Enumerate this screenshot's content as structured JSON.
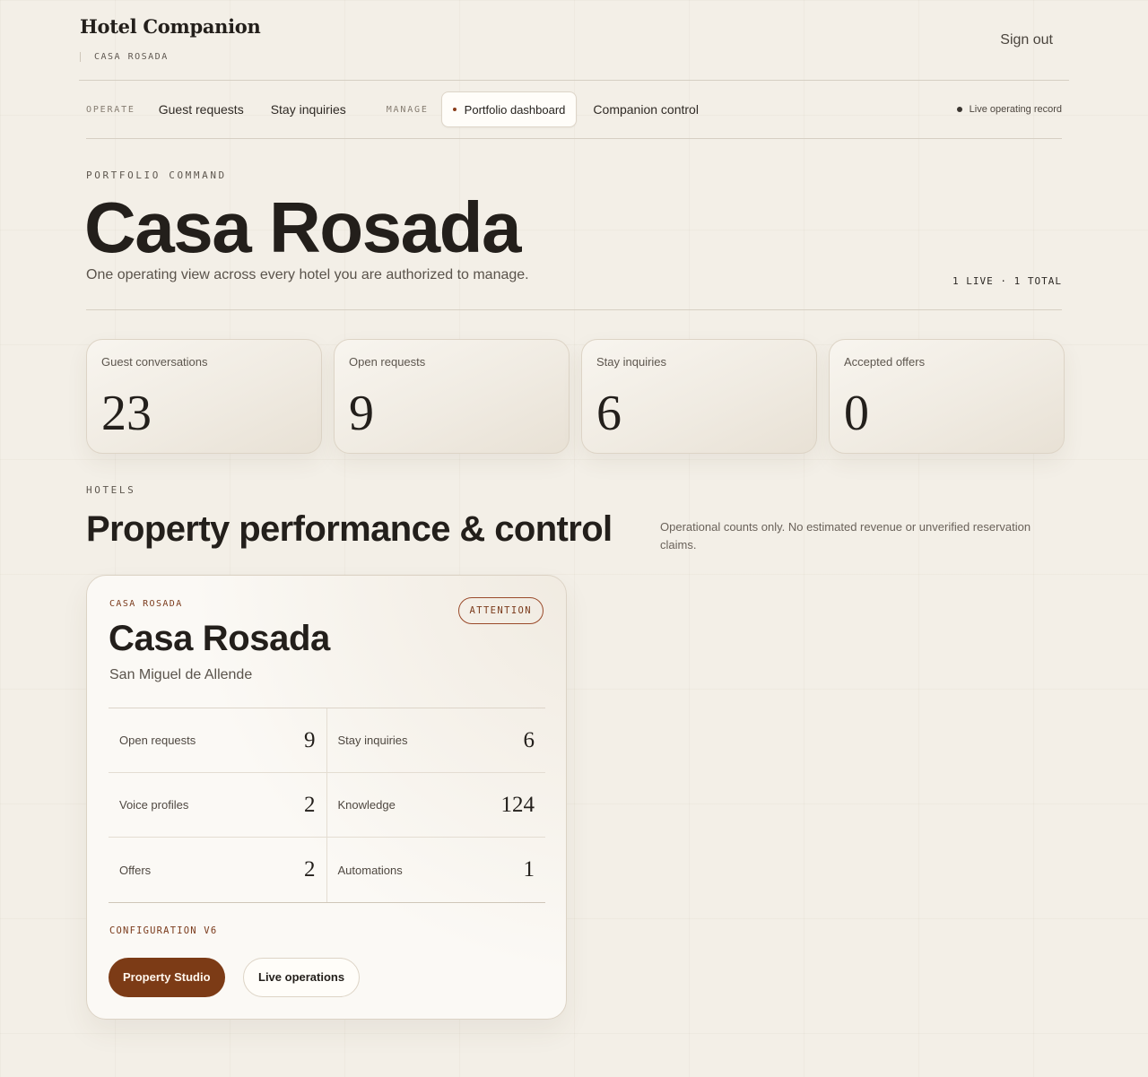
{
  "brand": {
    "title": "Hotel Companion",
    "property": "CASA ROSADA"
  },
  "header": {
    "sign_out": "Sign out"
  },
  "nav": {
    "group_operate": "OPERATE",
    "guest_requests": "Guest requests",
    "stay_inquiries": "Stay inquiries",
    "group_manage": "MANAGE",
    "portfolio_dashboard": "Portfolio dashboard",
    "companion_control": "Companion control",
    "live_record": "Live operating record"
  },
  "hero": {
    "eyebrow": "PORTFOLIO COMMAND",
    "title": "Casa Rosada",
    "description": "One operating view across every hotel you are authorized to manage.",
    "count": "1 LIVE · 1 TOTAL"
  },
  "stats": [
    {
      "label": "Guest conversations",
      "value": "23"
    },
    {
      "label": "Open requests",
      "value": "9"
    },
    {
      "label": "Stay inquiries",
      "value": "6"
    },
    {
      "label": "Accepted offers",
      "value": "0"
    }
  ],
  "hotels": {
    "eyebrow": "HOTELS",
    "title": "Property performance & control",
    "note": "Operational counts only. No estimated revenue or unverified reservation claims."
  },
  "hotel_card": {
    "kicker": "CASA ROSADA",
    "badge": "ATTENTION",
    "name": "Casa Rosada",
    "city": "San Miguel de Allende",
    "metrics": [
      {
        "label": "Open requests",
        "value": "9"
      },
      {
        "label": "Stay inquiries",
        "value": "6"
      },
      {
        "label": "Voice profiles",
        "value": "2"
      },
      {
        "label": "Knowledge",
        "value": "124"
      },
      {
        "label": "Offers",
        "value": "2"
      },
      {
        "label": "Automations",
        "value": "1"
      }
    ],
    "config": "CONFIGURATION V6",
    "primary_button": "Property Studio",
    "secondary_button": "Live operations"
  },
  "colors": {
    "accent": "#7c3b16",
    "background": "#f3efe7",
    "text": "#231f1b"
  }
}
